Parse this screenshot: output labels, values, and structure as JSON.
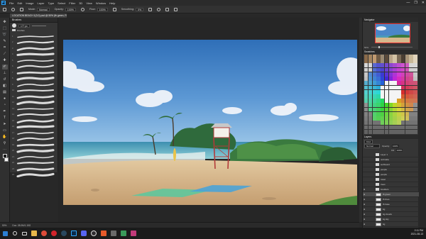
{
  "menubar": {
    "app_logo": "Ps",
    "items": [
      "File",
      "Edit",
      "Image",
      "Layer",
      "Type",
      "Select",
      "Filter",
      "3D",
      "View",
      "Window",
      "Help"
    ],
    "window_controls": [
      "—",
      "❐",
      "✕"
    ]
  },
  "options_bar": {
    "mode_label": "Mode:",
    "mode_value": "Normal",
    "opacity_label": "Opacity:",
    "opacity_value": "100%",
    "flow_label": "Flow:",
    "flow_value": "100%",
    "smoothing_label": "Smoothing:",
    "smoothing_value": "0%"
  },
  "document_tab": {
    "title": "LOCATION BEACH 1(3.0) psd @ 50% (fb green, RGB/8)"
  },
  "tools": [
    "move-icon",
    "marquee-icon",
    "lasso-icon",
    "quick-select-icon",
    "crop-icon",
    "eyedropper-icon",
    "healing-icon",
    "brush-icon",
    "clone-stamp-icon",
    "history-brush-icon",
    "eraser-icon",
    "gradient-icon",
    "blur-icon",
    "dodge-icon",
    "pen-icon",
    "type-icon",
    "path-select-icon",
    "rectangle-icon",
    "hand-icon",
    "zoom-icon",
    "more-icon"
  ],
  "brushes_panel": {
    "title": "Brushes",
    "size_value": "177 px",
    "folder_name": "brushes",
    "brush_numbers": [
      "1",
      "2",
      "3",
      "4",
      "5",
      "6",
      "7",
      "8",
      "9",
      "10",
      "11",
      "12",
      "13",
      "14",
      "15",
      "16",
      "17",
      "18",
      "19",
      "20",
      "21",
      "22",
      "23",
      "24"
    ]
  },
  "status_bar": {
    "zoom": "50%",
    "doc_size": "Doc: 28.0M/1.15G"
  },
  "navigator": {
    "title": "Navigator",
    "zoom": "50%"
  },
  "swatches": {
    "title": "Swatches"
  },
  "layers_panel": {
    "title": "Layers",
    "kind_label": "Kind",
    "blend_mode": "Normal",
    "opacity_label": "Opacity:",
    "opacity_value": "100%",
    "fill_label": "Fill:",
    "fill_value": "100%",
    "layers": [
      {
        "name": "Layer 1",
        "type": "folder",
        "visible": false
      },
      {
        "name": "umbrella",
        "type": "folder",
        "visible": false
      },
      {
        "name": "surfboard",
        "type": "folder",
        "visible": false
      },
      {
        "name": "people",
        "type": "folder",
        "visible": false
      },
      {
        "name": "people",
        "type": "folder",
        "visible": false
      },
      {
        "name": "towel",
        "type": "folder",
        "visible": false
      },
      {
        "name": "trees",
        "type": "folder",
        "visible": false
      },
      {
        "name": "boulders",
        "type": "folder",
        "visible": true
      },
      {
        "name": "fb green",
        "type": "layer",
        "visible": true,
        "selected": true
      },
      {
        "name": "fb lines",
        "type": "layer",
        "visible": true
      },
      {
        "name": "fb base",
        "type": "layer",
        "visible": true
      },
      {
        "name": "bg",
        "type": "layer",
        "visible": true
      },
      {
        "name": "bg clouds",
        "type": "layer",
        "visible": true
      },
      {
        "name": "bg sky",
        "type": "layer",
        "visible": true
      },
      {
        "name": "bg",
        "type": "layer",
        "visible": true
      }
    ]
  },
  "taskbar": {
    "apps": [
      "windows-start-icon",
      "search-icon",
      "task-view-icon",
      "file-explorer-icon",
      "chrome-icon",
      "opera-icon",
      "steam-icon",
      "photoshop-icon",
      "discord-icon",
      "obs-icon",
      "app-icon",
      "app-icon",
      "app-icon",
      "media-icon"
    ],
    "time": "2:11 PM",
    "date": "2021-08-13"
  },
  "colors": {
    "accent": "#31a8ff",
    "ui_dark": "#282828",
    "panel": "#353535"
  }
}
